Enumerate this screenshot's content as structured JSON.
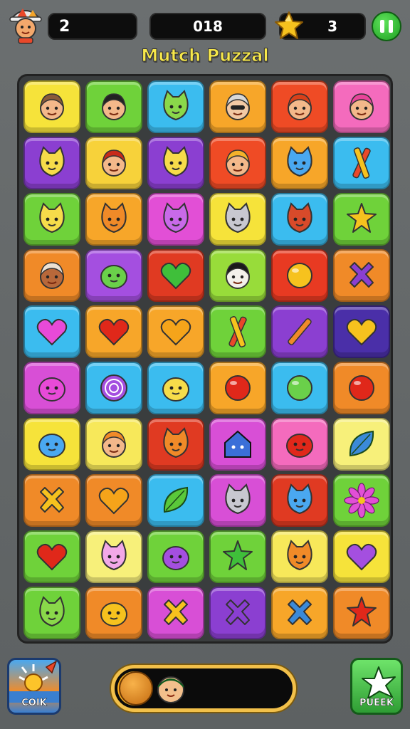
{
  "header": {
    "level": "2",
    "score": "018",
    "stars": "3",
    "title": "Mutch Puzzal"
  },
  "board": {
    "rows": [
      [
        {
          "icon": "boy-face-icon",
          "color": "#f6e33a"
        },
        {
          "icon": "cat-girl-face-icon",
          "color": "#6fd23a"
        },
        {
          "icon": "green-cat-face-icon",
          "color": "#3bbcef"
        },
        {
          "icon": "grandma-face-icon",
          "color": "#f7a629"
        },
        {
          "icon": "redhead-girl-face-icon",
          "color": "#ef4b25"
        },
        {
          "icon": "pink-hair-girl-face-icon",
          "color": "#f46bbd"
        }
      ],
      [
        {
          "icon": "yellow-cat-face-icon",
          "color": "#8b3fd1"
        },
        {
          "icon": "red-hair-girl-face-icon",
          "color": "#f7d23a"
        },
        {
          "icon": "yellow-cat-face-icon",
          "color": "#8b3fd1"
        },
        {
          "icon": "blonde-girl-face-icon",
          "color": "#ef4b25"
        },
        {
          "icon": "blue-cat-face-icon",
          "color": "#f7a629"
        },
        {
          "icon": "cross-sticks-icon",
          "color": "#3bbcef"
        }
      ],
      [
        {
          "icon": "yellow-cat-face-icon",
          "color": "#6fd23a"
        },
        {
          "icon": "orange-cat-face-icon",
          "color": "#f7a629"
        },
        {
          "icon": "purple-cat-face-icon",
          "color": "#e24fd6"
        },
        {
          "icon": "grey-cat-face-icon",
          "color": "#f6e33a"
        },
        {
          "icon": "red-cat-face-icon",
          "color": "#3bbcef"
        },
        {
          "icon": "star-swirl-icon",
          "color": "#6fd23a"
        }
      ],
      [
        {
          "icon": "dark-boy-face-icon",
          "color": "#f08a28"
        },
        {
          "icon": "green-blob-face-icon",
          "color": "#a44fe0"
        },
        {
          "icon": "green-heart-icon",
          "color": "#e03a22"
        },
        {
          "icon": "black-hair-boy-face-icon",
          "color": "#98dc3a"
        },
        {
          "icon": "yellow-circle-icon",
          "color": "#e83a22"
        },
        {
          "icon": "purple-x-icon",
          "color": "#f08a28"
        }
      ],
      [
        {
          "icon": "pink-heart-icon",
          "color": "#3bbcef"
        },
        {
          "icon": "red-heart-icon",
          "color": "#f7a629"
        },
        {
          "icon": "orange-heart-icon",
          "color": "#f7a629"
        },
        {
          "icon": "cross-sticks-icon",
          "color": "#6fd23a"
        },
        {
          "icon": "orange-stick-icon",
          "color": "#8b3fd1"
        },
        {
          "icon": "yellow-heart-icon",
          "color": "#4a2fa8"
        }
      ],
      [
        {
          "icon": "pink-blob-face-icon",
          "color": "#d84fd6"
        },
        {
          "icon": "purple-spiral-icon",
          "color": "#3bbcef"
        },
        {
          "icon": "yellow-blob-face-icon",
          "color": "#3bbcef"
        },
        {
          "icon": "red-circle-icon",
          "color": "#f7a629"
        },
        {
          "icon": "green-swirl-icon",
          "color": "#3bbcef"
        },
        {
          "icon": "red-circle-icon",
          "color": "#f08a28"
        }
      ],
      [
        {
          "icon": "blue-blob-face-icon",
          "color": "#f6e33a"
        },
        {
          "icon": "orange-hair-boy-face-icon",
          "color": "#f7e85a"
        },
        {
          "icon": "orange-cat-face-icon",
          "color": "#e03a22"
        },
        {
          "icon": "blue-house-icon",
          "color": "#d84fd6"
        },
        {
          "icon": "red-blob-face-icon",
          "color": "#f46bbd"
        },
        {
          "icon": "blue-leaf-icon",
          "color": "#f7f07a"
        }
      ],
      [
        {
          "icon": "yellow-x-icon",
          "color": "#f08a28"
        },
        {
          "icon": "orange-heart-icon",
          "color": "#f08a28"
        },
        {
          "icon": "green-leaf-icon",
          "color": "#3bbcef"
        },
        {
          "icon": "grey-cat-face-icon",
          "color": "#d84fd6"
        },
        {
          "icon": "blue-cat-face-icon",
          "color": "#e03a22"
        },
        {
          "icon": "pink-flower-icon",
          "color": "#6fd23a"
        }
      ],
      [
        {
          "icon": "red-heart-icon",
          "color": "#6fd23a"
        },
        {
          "icon": "pink-cat-face-icon",
          "color": "#f7f07a"
        },
        {
          "icon": "purple-blob-face-icon",
          "color": "#6fd23a"
        },
        {
          "icon": "green-star-icon",
          "color": "#6fd23a"
        },
        {
          "icon": "orange-cat-face-icon",
          "color": "#f7e85a"
        },
        {
          "icon": "purple-heart-icon",
          "color": "#f6e33a"
        }
      ],
      [
        {
          "icon": "green-cat-face-icon",
          "color": "#6fd23a"
        },
        {
          "icon": "yellow-fist-icon",
          "color": "#f08a28"
        },
        {
          "icon": "yellow-x-icon",
          "color": "#d84fd6"
        },
        {
          "icon": "purple-x-icon",
          "color": "#8b3fd1"
        },
        {
          "icon": "blue-x-icon",
          "color": "#f7a629"
        },
        {
          "icon": "red-star-icon",
          "color": "#f08a28"
        }
      ]
    ]
  },
  "footer": {
    "left_button_label": "COIK",
    "right_button_label": "PUEEK",
    "progress": 0.2
  }
}
